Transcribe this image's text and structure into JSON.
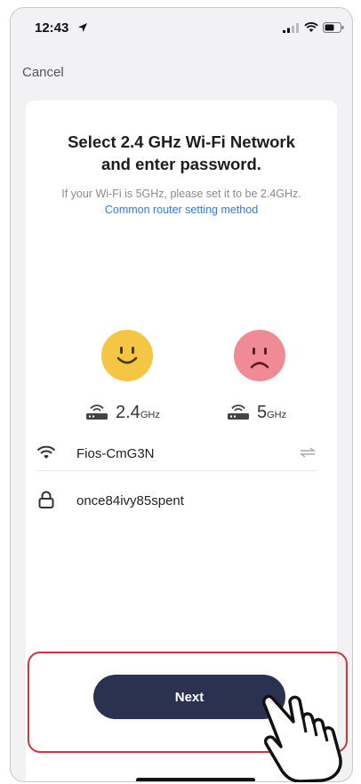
{
  "status_bar": {
    "time": "12:43",
    "icons": [
      "location-arrow-icon",
      "cellular-signal-icon",
      "wifi-icon",
      "battery-icon"
    ]
  },
  "nav": {
    "cancel_label": "Cancel"
  },
  "header": {
    "title_line1": "Select 2.4 GHz Wi-Fi Network",
    "title_line2": "and enter password.",
    "subtitle_text": "If your Wi-Fi is 5GHz, please set it to be 2.4GHz.",
    "subtitle_link": "Common router setting method"
  },
  "bands": [
    {
      "face": "happy-face-icon",
      "number": "2.4",
      "unit": "GHz",
      "color": "#f5c544"
    },
    {
      "face": "sad-face-icon",
      "number": "5",
      "unit": "GHz",
      "color": "#f08a94"
    }
  ],
  "form": {
    "ssid_value": "Fios-CmG3N",
    "password_value": "once84ivy85spent"
  },
  "actions": {
    "next_label": "Next",
    "button_color": "#2b3150",
    "highlight_color": "#d0343f"
  }
}
